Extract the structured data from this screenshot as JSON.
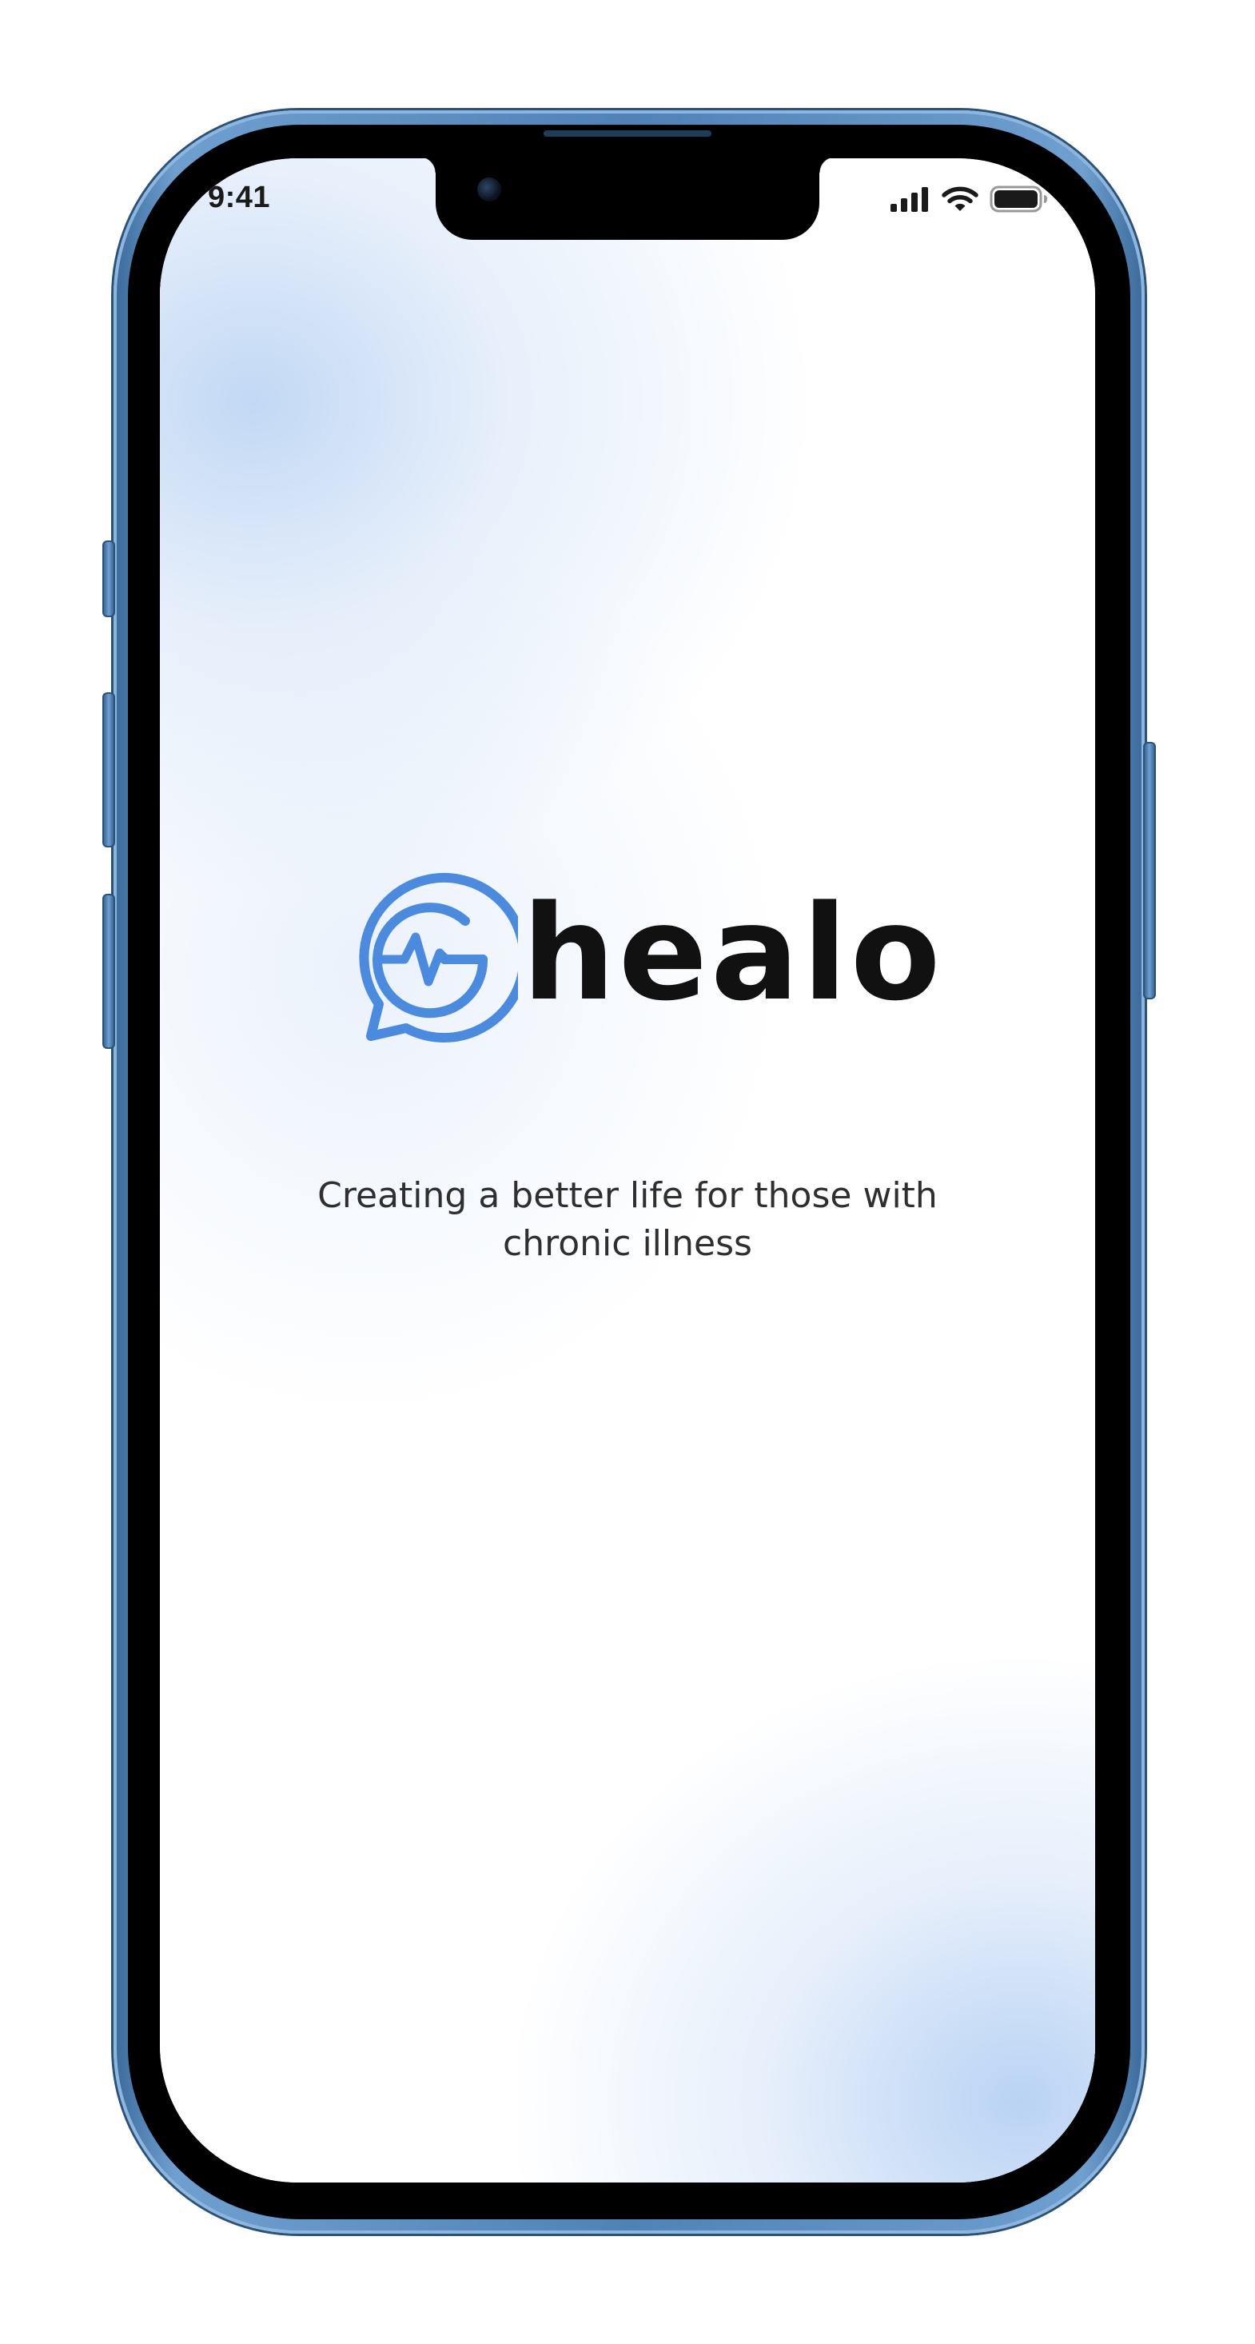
{
  "status_bar": {
    "time": "9:41",
    "icons": [
      "cellular-signal-icon",
      "wifi-icon",
      "battery-icon"
    ]
  },
  "app": {
    "brand_name": "healo",
    "logo_icon": "chat-bubble-heartbeat-icon",
    "tagline": "Creating a better life for those with chronic illness"
  },
  "colors": {
    "brand_blue": "#4a8be0",
    "wordmark": "#111111",
    "tagline_text": "#2f2f2f",
    "glow": "#bfd6f4",
    "device_frame": "#4f82b6"
  }
}
